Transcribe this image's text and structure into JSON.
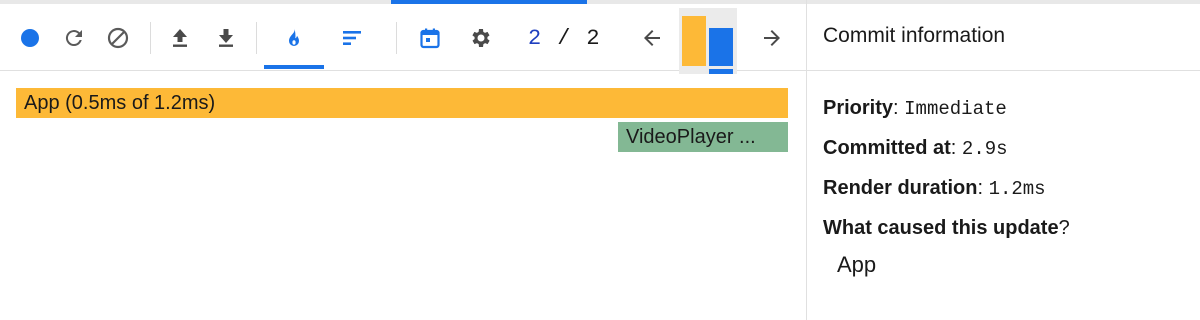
{
  "toolbar": {
    "buttons": [
      {
        "name": "record-icon",
        "color": "#1a73e8"
      },
      {
        "name": "reload-icon"
      },
      {
        "name": "clear-icon"
      },
      {
        "name": "upload-icon"
      },
      {
        "name": "download-icon"
      },
      {
        "name": "flamegraph-icon",
        "active": true
      },
      {
        "name": "ranked-icon"
      },
      {
        "name": "timeline-icon"
      },
      {
        "name": "settings-icon"
      }
    ],
    "commit_index": "2",
    "commit_separator": "/",
    "commit_total": "2",
    "prev_icon": "arrow-left-icon",
    "next_icon": "arrow-right-icon"
  },
  "commit_selector": {
    "commits": [
      {
        "color": "#fdb937",
        "relative_duration": 1.0
      },
      {
        "color": "#1a73e8",
        "relative_duration": 0.76,
        "selected": true
      }
    ]
  },
  "flamegraph": {
    "nodes": [
      {
        "label": "App (0.5ms of 1.2ms)",
        "color": "#fdb937"
      },
      {
        "label": "VideoPlayer ...",
        "color": "#83b894"
      }
    ]
  },
  "commit_info": {
    "title": "Commit information",
    "priority_label": "Priority",
    "priority_value": "Immediate",
    "committed_label": "Committed at",
    "committed_value": "2.9s",
    "duration_label": "Render duration",
    "duration_value": "1.2ms",
    "cause_label": "What caused this update",
    "cause_suffix": "?",
    "causes": [
      "App"
    ]
  },
  "colors": {
    "accent": "#1a73e8",
    "commit_orange": "#fdb937",
    "node_green": "#83b894"
  }
}
